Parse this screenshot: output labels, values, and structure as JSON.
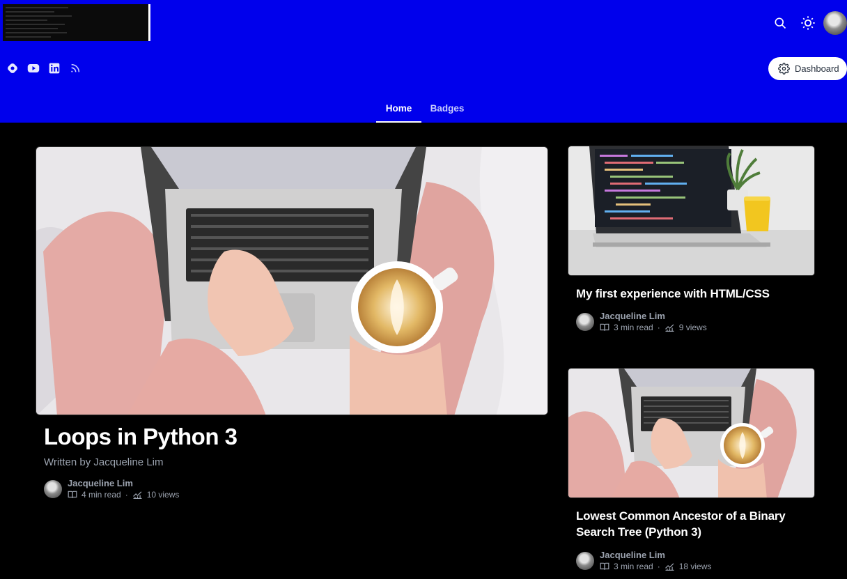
{
  "header": {
    "dashboard_label": "Dashboard",
    "icons": [
      "search-icon",
      "sun-icon",
      "avatar"
    ],
    "social_icons": [
      "hashnode-icon",
      "youtube-icon",
      "linkedin-icon",
      "rss-icon"
    ],
    "brand_color": "#0000ec"
  },
  "nav": {
    "tabs": [
      {
        "label": "Home",
        "active": true
      },
      {
        "label": "Badges",
        "active": false
      }
    ]
  },
  "featured": {
    "title": "Loops in Python 3",
    "subtitle": "Written by Jacqueline Lim",
    "author": "Jacqueline Lim",
    "read_time": "4 min read",
    "views": "10 views"
  },
  "posts": [
    {
      "title": "My first experience with HTML/CSS",
      "author": "Jacqueline Lim",
      "read_time": "3 min read",
      "views": "9 views"
    },
    {
      "title": "Lowest Common Ancestor of a Binary Search Tree (Python 3)",
      "author": "Jacqueline Lim",
      "read_time": "3 min read",
      "views": "18 views"
    }
  ]
}
